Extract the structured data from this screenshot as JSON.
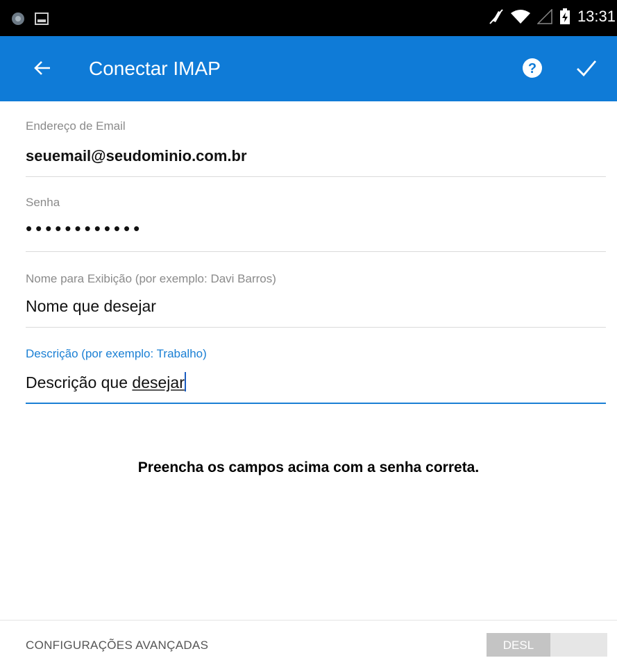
{
  "status_bar": {
    "time": "13:31"
  },
  "app_bar": {
    "title": "Conectar IMAP"
  },
  "form": {
    "email": {
      "label": "Endereço de Email",
      "value": "seuemail@seudominio.com.br"
    },
    "password": {
      "label": "Senha",
      "value": "••••••••••••"
    },
    "display_name": {
      "label": "Nome para Exibição (por exemplo: Davi Barros)",
      "value": "Nome que desejar"
    },
    "description": {
      "label": "Descrição (por exemplo: Trabalho)",
      "value_prefix": "Descrição que ",
      "value_underlined": "desejar"
    }
  },
  "note": "Preencha os campos acima com a senha correta.",
  "advanced": {
    "label": "CONFIGURAÇÕES AVANÇADAS",
    "toggle_state": "DESL"
  },
  "colors": {
    "accent": "#0f7bd7",
    "status_bar": "#000000"
  }
}
